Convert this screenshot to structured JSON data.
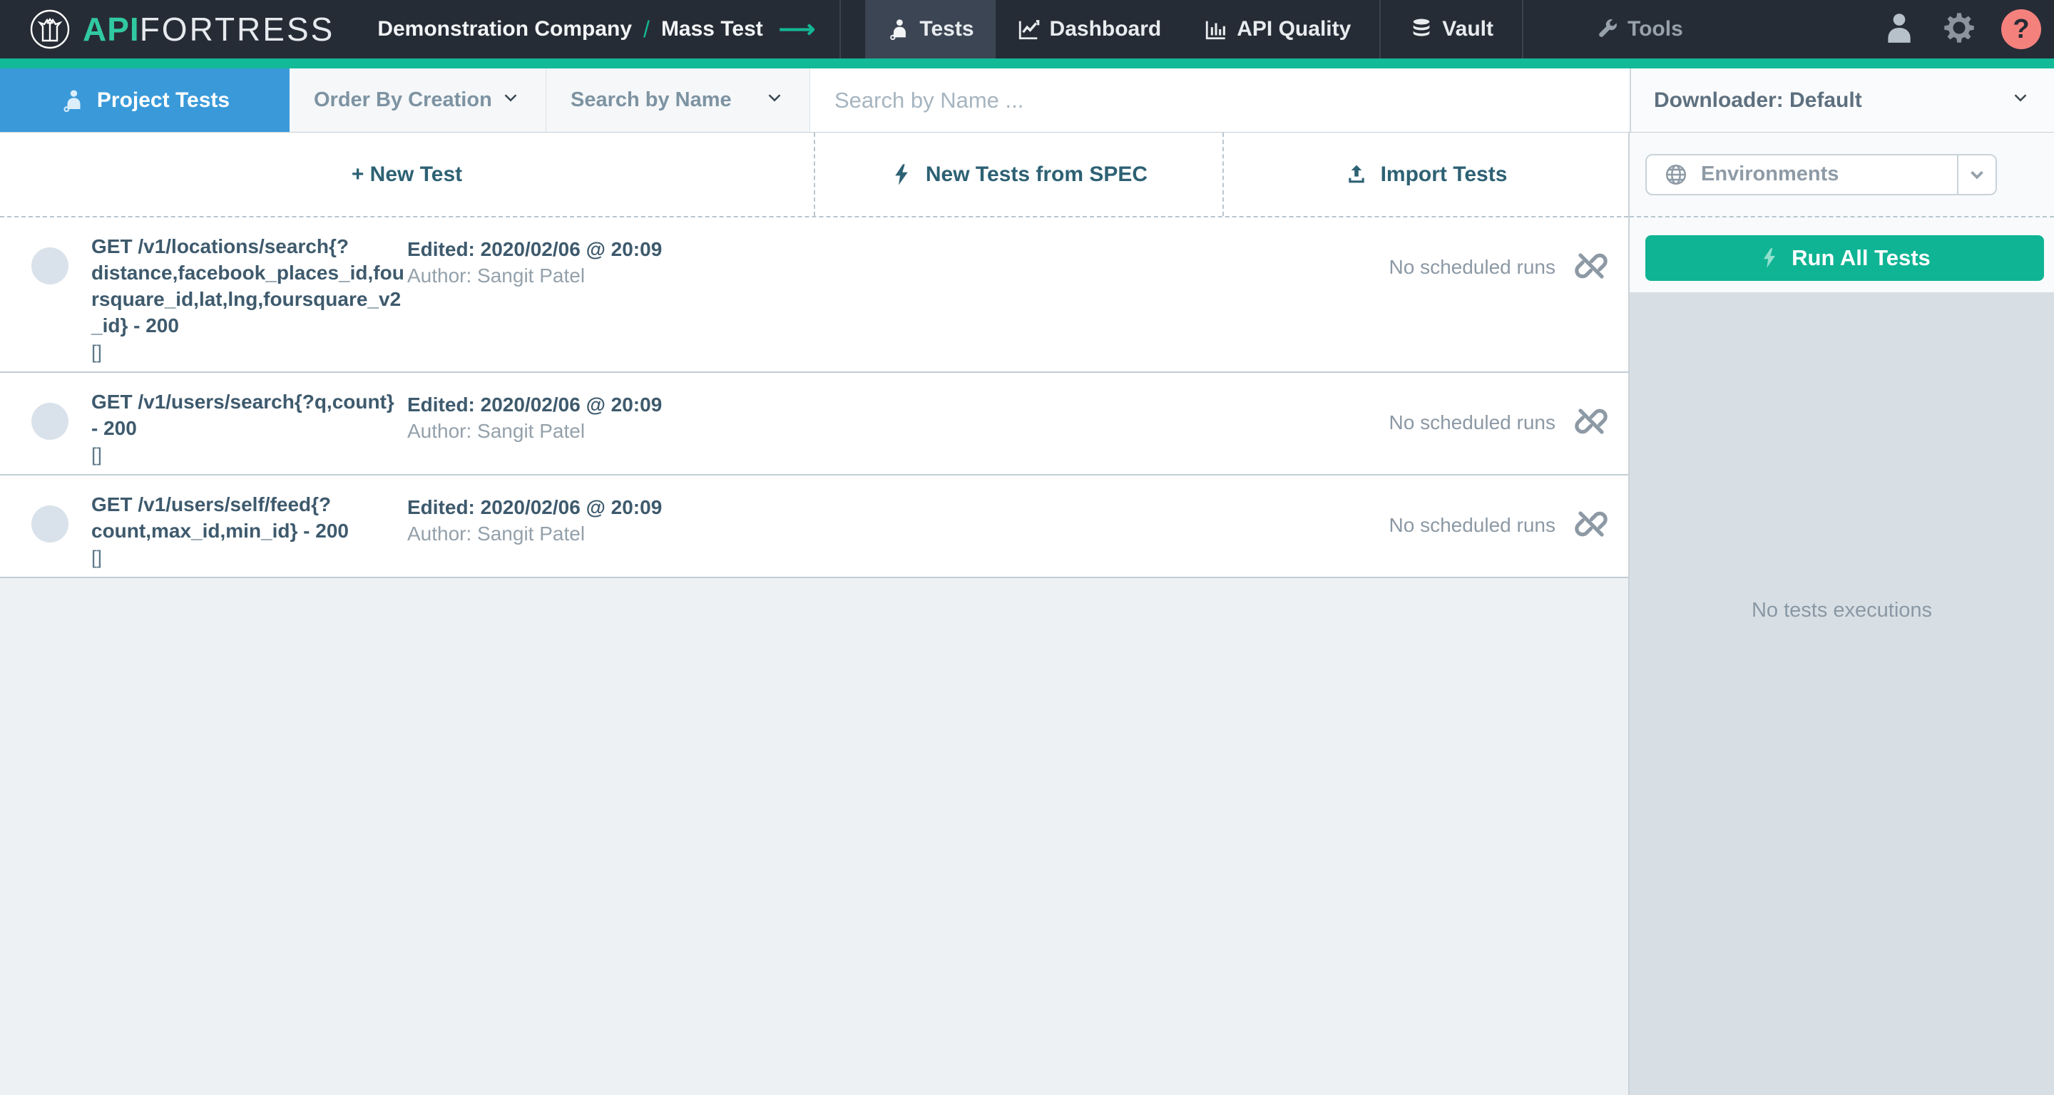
{
  "navbar": {
    "brand_primary": "API",
    "brand_secondary": "FORTRESS",
    "breadcrumb": {
      "company": "Demonstration Company",
      "separator": "/",
      "project": "Mass Test",
      "arrow": "⟶"
    },
    "tabs": {
      "tests": "Tests",
      "dashboard": "Dashboard",
      "api_quality": "API Quality",
      "vault": "Vault",
      "tools": "Tools"
    },
    "help_glyph": "?"
  },
  "filterbar": {
    "project_tests_label": "Project Tests",
    "order_dropdown": "Order By Creation",
    "search_mode_dropdown": "Search by Name",
    "search_placeholder": "Search by Name ...",
    "downloader_label": "Downloader: Default"
  },
  "actions": {
    "new_test": "+ New Test",
    "new_from_spec": "New Tests from SPEC",
    "import_tests": "Import Tests"
  },
  "right_panel": {
    "environments_label": "Environments",
    "run_all_label": "Run All Tests",
    "no_executions": "No tests executions"
  },
  "tests": [
    {
      "title": "GET /v1/locations/search{?distance,facebook_places_id,foursquare_id,lat,lng,foursquare_v2_id} - 200",
      "brackets": "[]",
      "edited": "Edited: 2020/02/06 @ 20:09",
      "author": "Author: Sangit Patel",
      "schedule": "No scheduled runs"
    },
    {
      "title": "GET /v1/users/search{?q,count} - 200",
      "brackets": "[]",
      "edited": "Edited: 2020/02/06 @ 20:09",
      "author": "Author: Sangit Patel",
      "schedule": "No scheduled runs"
    },
    {
      "title": "GET /v1/users/self/feed{?count,max_id,min_id} - 200",
      "brackets": "[]",
      "edited": "Edited: 2020/02/06 @ 20:09",
      "author": "Author: Sangit Patel",
      "schedule": "No scheduled runs"
    }
  ],
  "colors": {
    "teal": "#12ba98",
    "navbar_bg": "#262c35",
    "active_tab_bg": "#3c4553",
    "project_tab_blue": "#3a9ad9",
    "run_button": "#0fb494",
    "help_red": "#f5817d",
    "exec_bg": "#d7dfe5"
  }
}
